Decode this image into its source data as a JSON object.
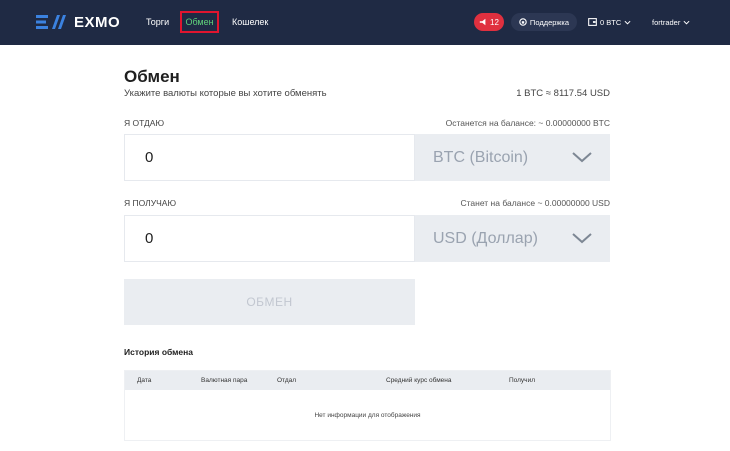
{
  "header": {
    "logo_text": "EXMO",
    "nav": [
      "Торги",
      "Обмен",
      "Кошелек"
    ],
    "notifications_count": "12",
    "support_label": "Поддержка",
    "wallet_label": "0 BTC",
    "user_label": "fortrader"
  },
  "main": {
    "title": "Обмен",
    "subtitle": "Укажите валюты которые вы хотите обменять",
    "rate": "1 BTC ≈ 8117.54 USD",
    "give": {
      "label": "Я ОТДАЮ",
      "balance": "Останется на балансе: ~ 0.00000000 BTC",
      "value": "0",
      "currency": "BTC (Bitcoin)"
    },
    "get": {
      "label": "Я ПОЛУЧАЮ",
      "balance": "Станет на балансе ~ 0.00000000 USD",
      "value": "0",
      "currency": "USD (Доллар)"
    },
    "exchange_button": "ОБМЕН"
  },
  "history": {
    "title": "История обмена",
    "columns": [
      "Дата",
      "Валютная пара",
      "Отдал",
      "Средний курс обмена",
      "Получил"
    ],
    "empty_text": "Нет информации для отображения"
  },
  "colors": {
    "header_bg": "#1f2a44",
    "logo_blue": "#3b82e0",
    "active_nav": "#5fd17a",
    "highlight_border": "#e0152f",
    "alert_badge": "#e0303f",
    "field_bg": "#eaedf1"
  },
  "icons": {
    "alert": "megaphone-icon",
    "support": "headset-icon",
    "wallet": "wallet-icon",
    "dropdown": "chevron-down-icon"
  }
}
